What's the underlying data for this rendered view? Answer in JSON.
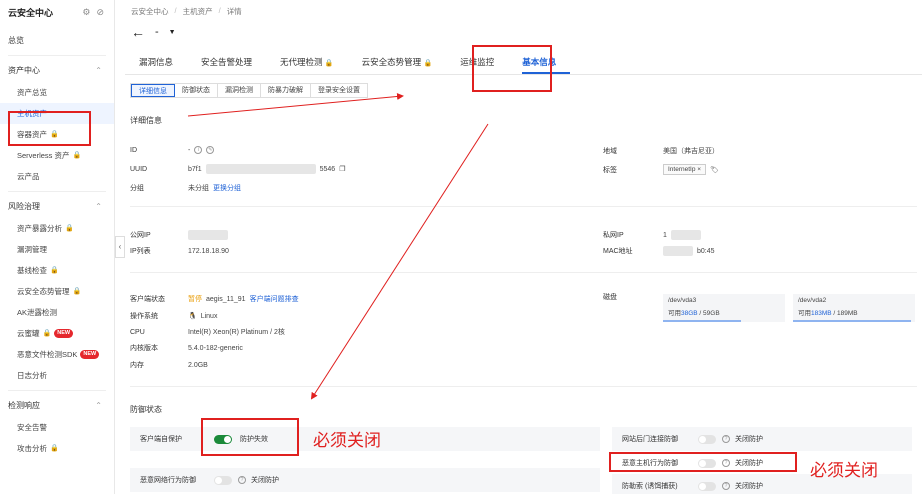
{
  "sidebar": {
    "title": "云安全中心",
    "overview": "总览",
    "groups": [
      {
        "label": "资产中心",
        "items": [
          "资产总览",
          "主机资产",
          "容器资产",
          "Serverless 资产",
          "云产品"
        ]
      },
      {
        "label": "风险治理",
        "items": [
          "资产暴露分析",
          "漏洞管理",
          "基线检查",
          "云安全态势管理",
          "AK泄露检测",
          "云蜜罐",
          "恶意文件检测SDK",
          "日志分析"
        ]
      },
      {
        "label": "检测响应",
        "items": [
          "安全告警",
          "攻击分析"
        ]
      }
    ],
    "new_badge": "NEW",
    "collapse_icon": "‹"
  },
  "breadcrumb": [
    "云安全中心",
    "主机资产",
    "详情"
  ],
  "page_title": "-",
  "tabs": [
    "漏洞信息",
    "安全告警处理",
    "无代理检测",
    "云安全态势管理",
    "运维监控",
    "基本信息"
  ],
  "subtabs": [
    "详细信息",
    "防御状态",
    "漏洞检测",
    "防暴力破解",
    "登录安全设置"
  ],
  "details": {
    "section": "详细信息",
    "id_label": "ID",
    "id_value": "-",
    "uuid_label": "UUID",
    "uuid_prefix": "b7f1",
    "uuid_suffix": "5546",
    "group_label": "分组",
    "group_value": "未分组",
    "group_link": "更换分组",
    "region_label": "地域",
    "region_value": "美国（弗吉尼亚）",
    "tag_label": "标签",
    "tag_value": "InternetIp",
    "public_ip_label": "公网IP",
    "ip_list_label": "IP列表",
    "ip_list_value": "172.18.18.90",
    "private_ip_label": "私网IP",
    "private_ip_prefix": "1",
    "mac_label": "MAC地址",
    "mac_suffix": "b0:45",
    "client_status_label": "客户端状态",
    "client_status": "暂停",
    "client_version": "aegis_11_91",
    "client_link": "客户端问题排查",
    "os_label": "操作系统",
    "os_value": "Linux",
    "cpu_label": "CPU",
    "cpu_value": "Intel(R) Xeon(R) Platinum / 2核",
    "kernel_label": "内核版本",
    "kernel_value": "5.4.0-182-generic",
    "mem_label": "内存",
    "mem_value": "2.0GB",
    "disk_label": "磁盘",
    "disks": [
      {
        "name": "/dev/vda3",
        "prefix": "可用",
        "used": "38GB",
        "total": " / 59GB",
        "fraction": 0.64
      },
      {
        "name": "/dev/vda2",
        "prefix": "可用",
        "used": "183MB",
        "total": " / 189MB",
        "fraction": 0.97
      }
    ]
  },
  "protection": {
    "section": "防御状态",
    "items": [
      {
        "label": "客户端自保护",
        "state": "防护失效",
        "on": true
      },
      {
        "label": "恶意网络行为防御",
        "state": "关闭防护",
        "on": false
      },
      {
        "label": "网站后门连接防御",
        "state": "关闭防护",
        "on": false
      },
      {
        "label": "恶意主机行为防御",
        "state": "关闭防护",
        "on": false
      },
      {
        "label": "防勒索 (诱饵捕获)",
        "state": "关闭防护",
        "on": false
      }
    ]
  },
  "annotations": {
    "must_close": "必须关闭"
  },
  "colors": {
    "accent": "#1f62d6",
    "annotation": "#e0201f",
    "toggle_on": "#1b8a3a",
    "warn": "#e89a00"
  }
}
